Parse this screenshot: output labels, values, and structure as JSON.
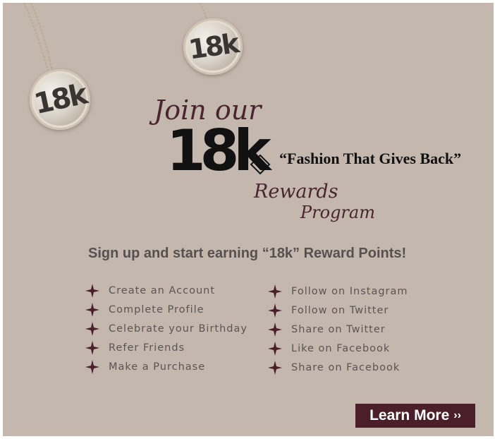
{
  "colors": {
    "panel_bg": "#c4b8ae",
    "accent": "#4a1f2a",
    "script_text": "#4a2530",
    "body_text": "#5a5454"
  },
  "pendants": [
    {
      "label": "18k"
    },
    {
      "label": "18k"
    }
  ],
  "heading": {
    "join": "Join our",
    "brand": "18k",
    "tagline": "“Fashion That Gives Back”",
    "rewards": "Rewards",
    "program": "Program"
  },
  "signup_text": "Sign up and start earning “18k” Reward Points!",
  "ways_left": [
    {
      "icon": "plus-star-icon",
      "label": "Create an Account"
    },
    {
      "icon": "plus-star-icon",
      "label": "Complete Profile"
    },
    {
      "icon": "plus-star-icon",
      "label": "Celebrate your Birthday"
    },
    {
      "icon": "plus-star-icon",
      "label": "Refer Friends"
    },
    {
      "icon": "plus-star-icon",
      "label": "Make a Purchase"
    }
  ],
  "ways_right": [
    {
      "icon": "plus-star-icon",
      "label": "Follow on Instagram"
    },
    {
      "icon": "plus-star-icon",
      "label": "Follow on Twitter"
    },
    {
      "icon": "plus-star-icon",
      "label": "Share on Twitter"
    },
    {
      "icon": "plus-star-icon",
      "label": "Like on Facebook"
    },
    {
      "icon": "plus-star-icon",
      "label": "Share on Facebook"
    }
  ],
  "cta": {
    "label": "Learn More",
    "arrows": "››"
  }
}
